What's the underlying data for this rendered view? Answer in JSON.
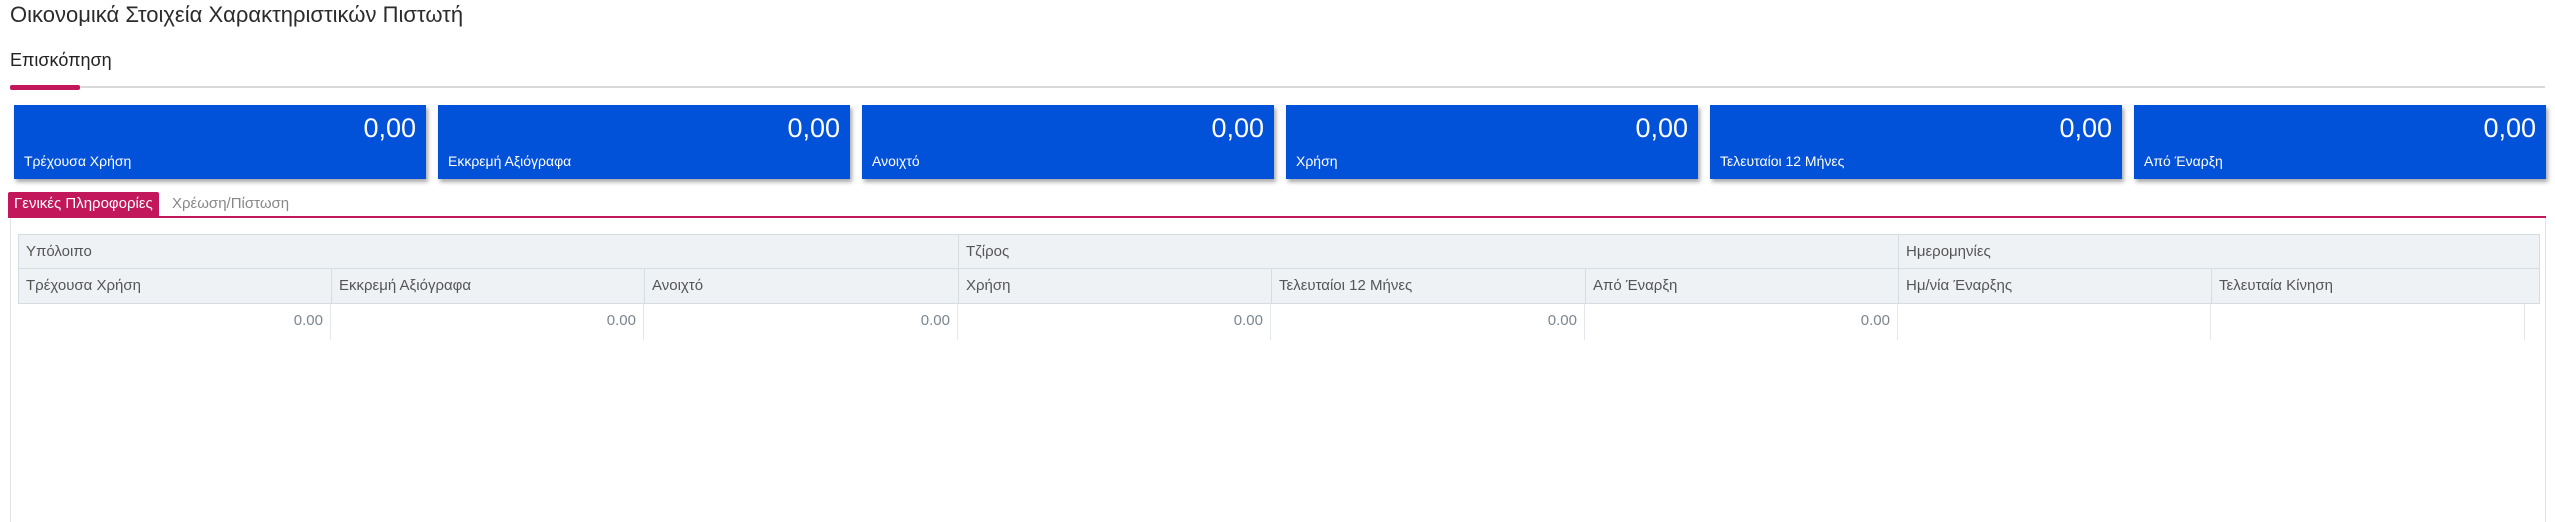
{
  "page": {
    "title": "Οικονομικά Στοιχεία Χαρακτηριστικών Πιστωτή"
  },
  "main_tabs": [
    {
      "label": "Επισκόπηση"
    }
  ],
  "cards": [
    {
      "value": "0,00",
      "label": "Τρέχουσα Χρήση"
    },
    {
      "value": "0,00",
      "label": "Εκκρεμή Αξιόγραφα"
    },
    {
      "value": "0,00",
      "label": "Ανοιχτό"
    },
    {
      "value": "0,00",
      "label": "Χρήση"
    },
    {
      "value": "0,00",
      "label": "Τελευταίοι 12 Μήνες"
    },
    {
      "value": "0,00",
      "label": "Από Έναρξη"
    }
  ],
  "sub_tabs": [
    {
      "label": "Γενικές Πληροφορίες"
    },
    {
      "label": "Χρέωση/Πίστωση"
    }
  ],
  "grid": {
    "groups": [
      "Υπόλοιπο",
      "Τζίρος",
      "Ημερομηνίες"
    ],
    "columns": [
      "Τρέχουσα Χρήση",
      "Εκκρεμή Αξιόγραφα",
      "Ανοιχτό",
      "Χρήση",
      "Τελευταίοι 12 Μήνες",
      "Από Έναρξη",
      "Ημ/νία Έναρξης",
      "Τελευταία Κίνηση"
    ],
    "rows": [
      [
        "0.00",
        "0.00",
        "0.00",
        "0.00",
        "0.00",
        "0.00",
        "",
        ""
      ]
    ]
  },
  "colors": {
    "card_bg": "#0251d9",
    "accent": "#c2185b",
    "header_bg": "#eef2f5"
  }
}
